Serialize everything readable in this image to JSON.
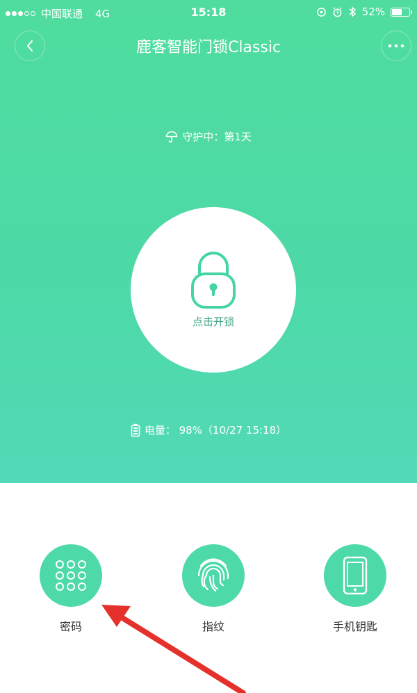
{
  "status_bar": {
    "carrier": "中国联通",
    "network": "4G",
    "time": "15:18",
    "battery_percent_text": "52%",
    "battery_level": 0.52
  },
  "nav": {
    "title": "鹿客智能门锁Classic",
    "back_icon": "chevron-left-icon",
    "more_icon": "more-dots-icon"
  },
  "guard": {
    "text": "守护中：第1天",
    "icon": "umbrella-icon"
  },
  "lock": {
    "label": "点击开锁",
    "icon": "padlock-icon"
  },
  "battery": {
    "text": "电量： 98%（10/27 15:18）",
    "icon": "battery-icon"
  },
  "methods": [
    {
      "label": "密码",
      "icon": "keypad-icon"
    },
    {
      "label": "指纹",
      "icon": "fingerprint-icon"
    },
    {
      "label": "手机钥匙",
      "icon": "phone-icon"
    }
  ],
  "colors": {
    "primary_green": "#4ed9a9",
    "arrow_red": "#e5312b"
  }
}
